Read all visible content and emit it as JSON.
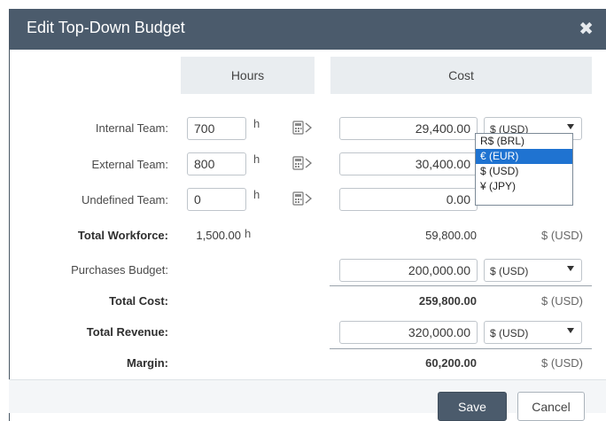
{
  "dialog": {
    "title": "Edit Top-Down Budget",
    "close_icon": "close-icon"
  },
  "columns": {
    "hours": "Hours",
    "cost": "Cost"
  },
  "rows": {
    "internal": {
      "label": "Internal Team:",
      "hours": "700",
      "unit": "h",
      "cost": "29,400.00",
      "currency": "$ (USD)"
    },
    "external": {
      "label": "External Team:",
      "hours": "800",
      "unit": "h",
      "cost": "30,400.00"
    },
    "undefined": {
      "label": "Undefined Team:",
      "hours": "0",
      "unit": "h",
      "cost": "0.00"
    },
    "total_workforce": {
      "label": "Total Workforce:",
      "hours": "1,500.00",
      "unit": "h",
      "cost": "59,800.00",
      "currency": "$ (USD)"
    },
    "purchases": {
      "label": "Purchases Budget:",
      "cost": "200,000.00",
      "currency": "$ (USD)"
    },
    "total_cost": {
      "label": "Total Cost:",
      "cost": "259,800.00",
      "currency": "$ (USD)"
    },
    "total_revenue": {
      "label": "Total Revenue:",
      "cost": "320,000.00",
      "currency": "$ (USD)"
    },
    "margin": {
      "label": "Margin:",
      "cost": "60,200.00",
      "currency": "$ (USD)"
    }
  },
  "currency_dropdown": {
    "options": [
      "R$ (BRL)",
      "€ (EUR)",
      "$ (USD)",
      "¥ (JPY)"
    ],
    "highlighted": "€ (EUR)"
  },
  "buttons": {
    "save": "Save",
    "cancel": "Cancel"
  },
  "colors": {
    "titlebar": "#4b5b6c",
    "highlight": "#1f73d1",
    "header_bg": "#e9edf0"
  }
}
